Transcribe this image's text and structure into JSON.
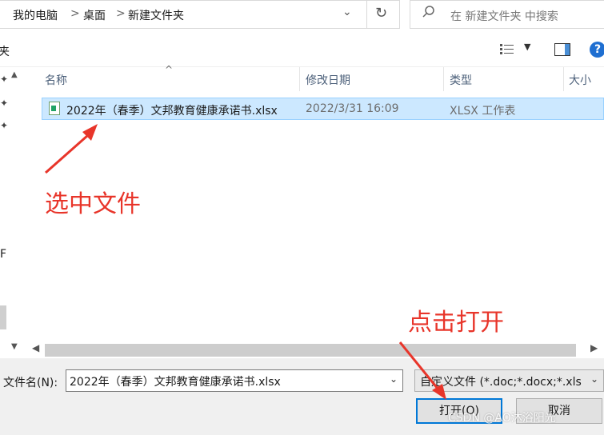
{
  "address_bar": {
    "crumbs": [
      "我的电脑",
      "桌面",
      "新建文件夹"
    ],
    "separator": ">",
    "dropdown_glyph": "⌄",
    "refresh_glyph": "↻"
  },
  "search": {
    "placeholder": "在 新建文件夹 中搜索",
    "icon": "search-icon"
  },
  "toolbar": {
    "left_fragment": "夹",
    "help_label": "?"
  },
  "nav": {
    "fragment": "F"
  },
  "columns": {
    "name": "名称",
    "modified": "修改日期",
    "type": "类型",
    "size": "大小"
  },
  "files": [
    {
      "name": "2022年（春季）文邦教育健康承诺书.xlsx",
      "modified": "2022/3/31 16:09",
      "type": "XLSX 工作表",
      "selected": true
    }
  ],
  "annotations": {
    "select_file": "选中文件",
    "click_open": "点击打开",
    "color": "#e8352a"
  },
  "bottom": {
    "filename_label": "文件名(N):",
    "filename_value": "2022年（春季）文邦教育健康承诺书.xlsx",
    "filetype_value": "自定义文件 (*.doc;*.docx;*.xls",
    "open_label": "打开(O)",
    "cancel_label": "取消"
  },
  "watermark": "CSDN @AO沐浴阳光",
  "colors": {
    "selection": "#cce8ff",
    "accent": "#0078d7"
  }
}
